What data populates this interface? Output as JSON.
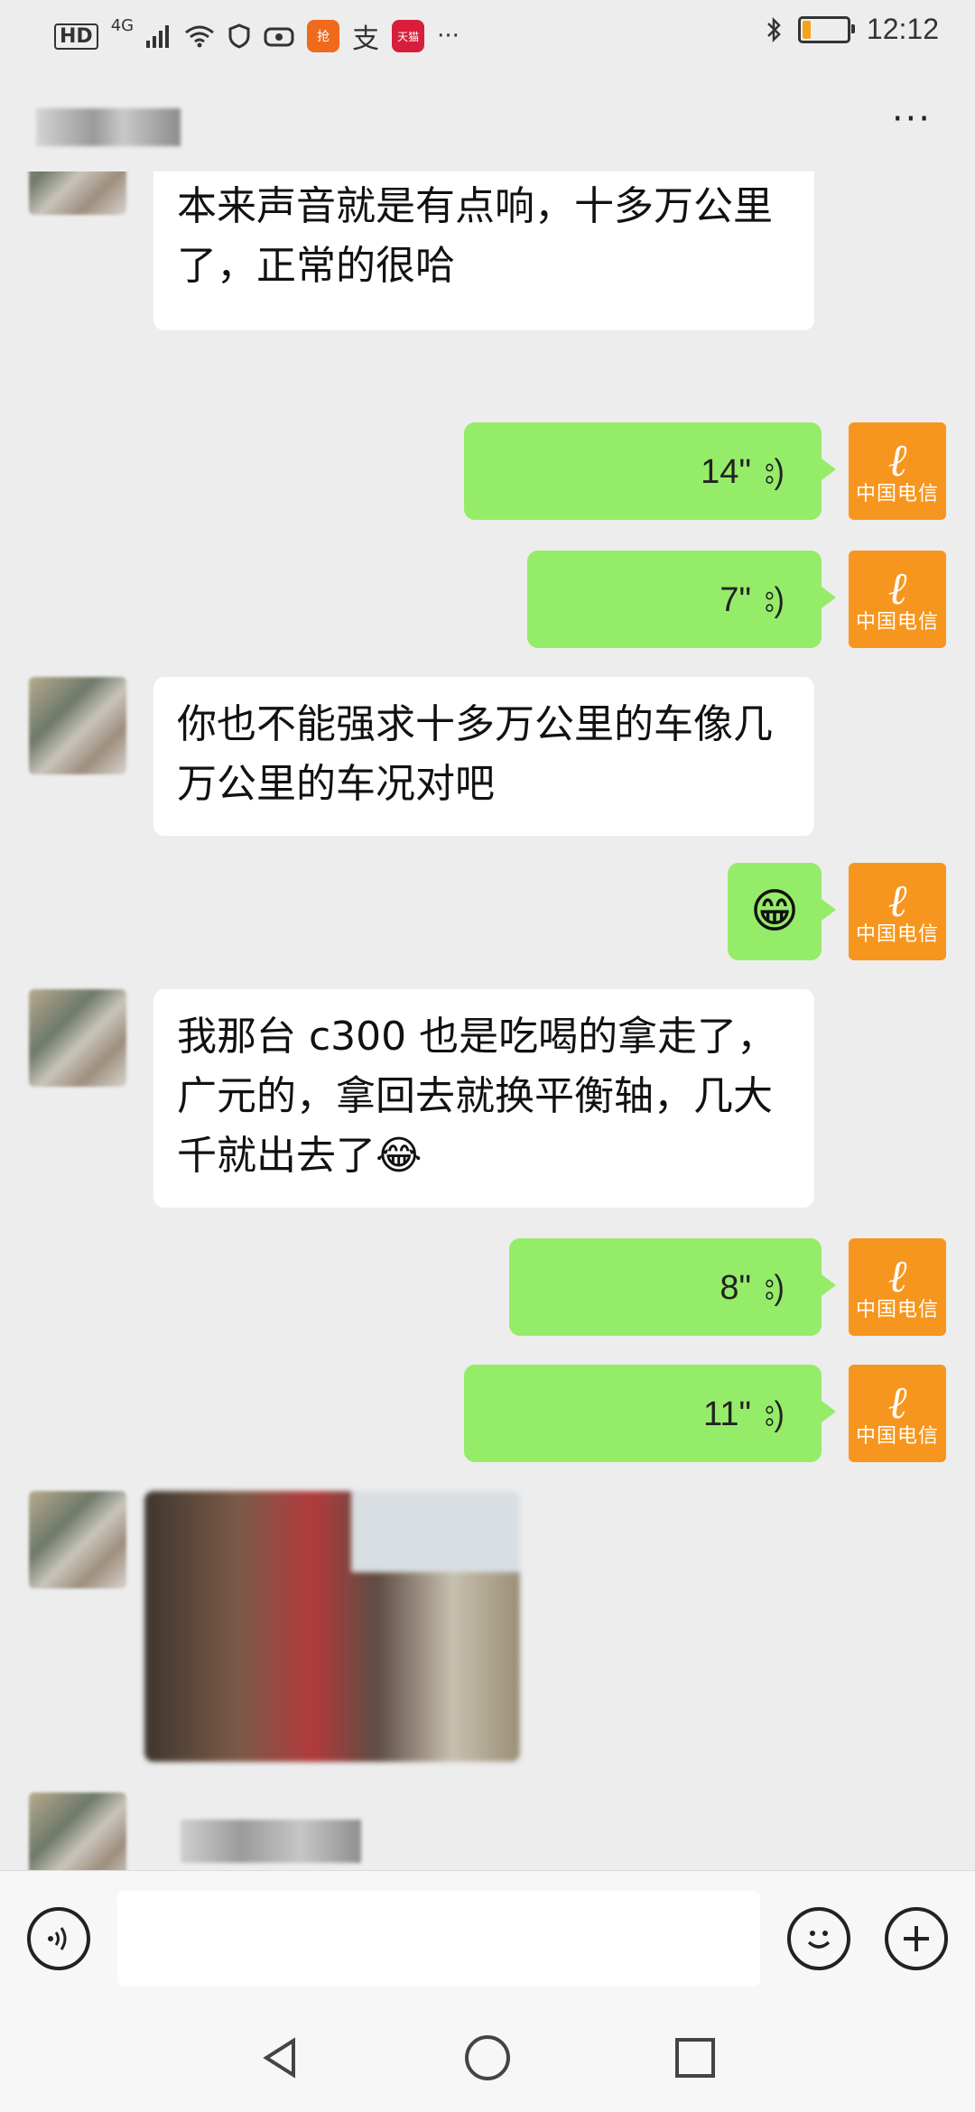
{
  "status_bar": {
    "hd": "HD",
    "network": "4G",
    "clock": "12:12",
    "more": "···",
    "app_icons": [
      {
        "name": "alipay-icon",
        "glyph": "支"
      },
      {
        "name": "tmall-icon",
        "glyph": "天猫"
      }
    ]
  },
  "title_bar": {
    "more_label": "···"
  },
  "messages": [
    {
      "side": "left",
      "type": "text",
      "text": "修哈，另外，福克斯的发动机气门本来声音就是有点响，十多万公里了，正常的很哈"
    },
    {
      "side": "right",
      "type": "voice",
      "duration": "14\""
    },
    {
      "side": "right",
      "type": "voice",
      "duration": "7\""
    },
    {
      "side": "left",
      "type": "text",
      "text": "你也不能强求十多万公里的车像几万公里的车况对吧"
    },
    {
      "side": "right",
      "type": "emoji",
      "text": "😁"
    },
    {
      "side": "left",
      "type": "text",
      "text": "我那台 c300 也是吃喝的拿走了，广元的，拿回去就换平衡轴，几大千就出去了😂"
    },
    {
      "side": "right",
      "type": "voice",
      "duration": "8\""
    },
    {
      "side": "right",
      "type": "voice",
      "duration": "11\""
    },
    {
      "side": "left",
      "type": "image"
    },
    {
      "side": "left",
      "type": "blurred"
    }
  ],
  "avatar": {
    "telecom_glyph": "ℓ",
    "telecom_caption": "中国电信"
  },
  "input_bar": {
    "placeholder": ""
  },
  "colors": {
    "background": "#ededed",
    "incoming_bubble": "#ffffff",
    "outgoing_bubble": "#95ec69",
    "avatar_orange": "#f7961e"
  }
}
